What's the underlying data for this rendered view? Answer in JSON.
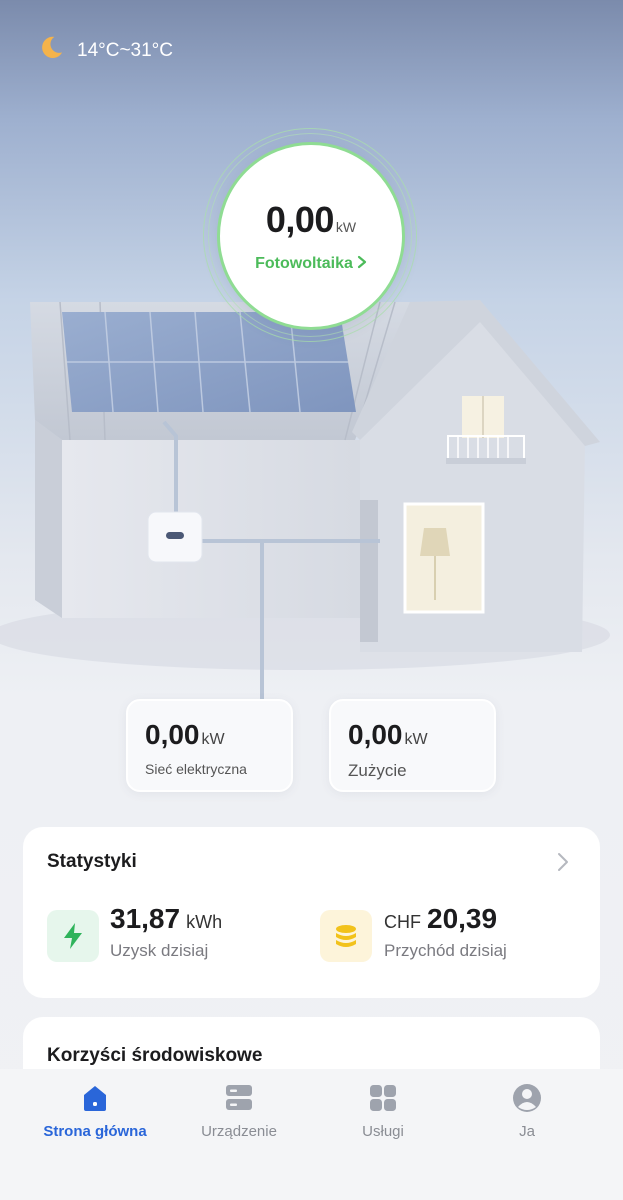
{
  "weather": {
    "icon": "moon-icon",
    "temperature_range": "14°C~31°C"
  },
  "photovoltaic": {
    "value": "0,00",
    "unit": "kW",
    "label": "Fotowoltaika",
    "accent_color": "#4cbb5a"
  },
  "grid": {
    "value": "0,00",
    "unit": "kW",
    "label": "Sieć elektryczna"
  },
  "consumption": {
    "value": "0,00",
    "unit": "kW",
    "label": "Zużycie"
  },
  "statistics": {
    "title": "Statystyki",
    "yield": {
      "icon": "lightning-icon",
      "value": "31,87",
      "unit": "kWh",
      "label": "Uzysk dzisiaj",
      "color": "#2fb35b"
    },
    "revenue": {
      "icon": "coins-icon",
      "currency": "CHF",
      "value": "20,39",
      "label": "Przychód dzisiaj",
      "color": "#f2c21b"
    }
  },
  "environment": {
    "title": "Korzyści środowiskowe"
  },
  "tabbar": {
    "active_color": "#2a66d9",
    "tabs": [
      {
        "label": "Strona główna",
        "icon": "home-icon",
        "active": true
      },
      {
        "label": "Urządzenie",
        "icon": "device-icon",
        "active": false
      },
      {
        "label": "Usługi",
        "icon": "services-icon",
        "active": false
      },
      {
        "label": "Ja",
        "icon": "profile-icon",
        "active": false
      }
    ]
  }
}
